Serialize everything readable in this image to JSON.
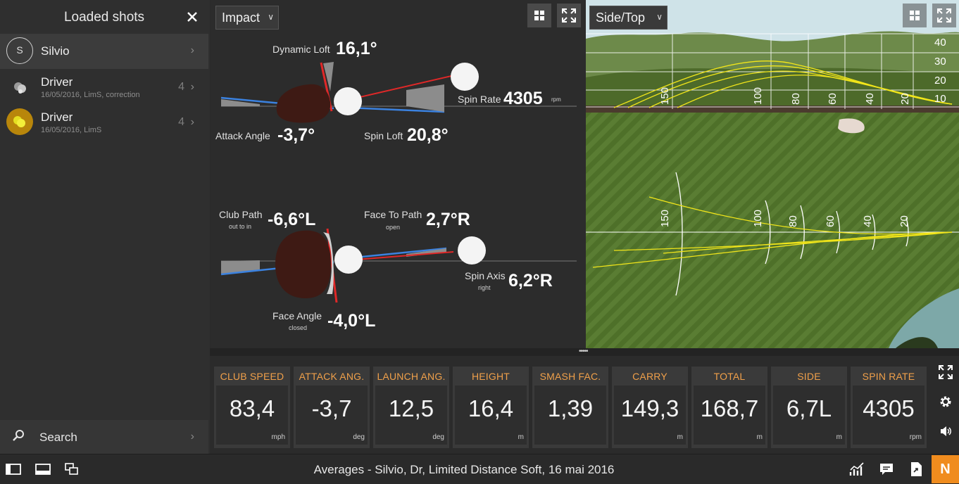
{
  "sidebar": {
    "title": "Loaded shots",
    "player": {
      "initial": "S",
      "name": "Silvio"
    },
    "shots": [
      {
        "title": "Driver",
        "subtitle": "16/05/2016, LimS, correction",
        "count": "4"
      },
      {
        "title": "Driver",
        "subtitle": "16/05/2016, LimS",
        "count": "4"
      }
    ],
    "search_label": "Search",
    "chevron": "›"
  },
  "impact": {
    "view_selector": "Impact",
    "metrics": {
      "dynamic_loft": {
        "label": "Dynamic Loft",
        "value": "16,1°"
      },
      "spin_rate": {
        "label": "Spin Rate",
        "value": "4305",
        "unit": "rpm"
      },
      "attack_angle": {
        "label": "Attack Angle",
        "value": "-3,7°"
      },
      "spin_loft": {
        "label": "Spin Loft",
        "value": "20,8°"
      },
      "club_path": {
        "label": "Club Path",
        "sub": "out to in",
        "value": "-6,6°L"
      },
      "face_to_path": {
        "label": "Face To Path",
        "sub": "open",
        "value": "2,7°R"
      },
      "spin_axis": {
        "label": "Spin Axis",
        "sub": "right",
        "value": "6,2°R"
      },
      "face_angle": {
        "label": "Face Angle",
        "sub": "closed",
        "value": "-4,0°L"
      }
    }
  },
  "trajectory": {
    "view_selector": "Side/Top",
    "side_height_labels": [
      "40",
      "30",
      "20",
      "10"
    ],
    "distance_labels": [
      "150",
      "100",
      "80",
      "60",
      "40",
      "20"
    ]
  },
  "stats": [
    {
      "label": "CLUB SPEED",
      "value": "83,4",
      "unit": "mph"
    },
    {
      "label": "ATTACK ANG.",
      "value": "-3,7",
      "unit": "deg"
    },
    {
      "label": "LAUNCH ANG.",
      "value": "12,5",
      "unit": "deg"
    },
    {
      "label": "HEIGHT",
      "value": "16,4",
      "unit": "m"
    },
    {
      "label": "SMASH FAC.",
      "value": "1,39",
      "unit": ""
    },
    {
      "label": "CARRY",
      "value": "149,3",
      "unit": "m"
    },
    {
      "label": "TOTAL",
      "value": "168,7",
      "unit": "m"
    },
    {
      "label": "SIDE",
      "value": "6,7L",
      "unit": "m"
    },
    {
      "label": "SPIN RATE",
      "value": "4305",
      "unit": "rpm"
    }
  ],
  "footer": {
    "status_text": "Averages - Silvio, Dr, Limited Distance Soft, 16 mai 2016",
    "n_button": "N"
  },
  "colors": {
    "accent_orange": "#f08c1e",
    "stat_header": "#f0a04a",
    "trajectory_line": "#f2e61a",
    "attack_line_blue": "#3b82e0",
    "face_line_red": "#e02828"
  },
  "icons": [
    "close-icon",
    "chevron-right-icon",
    "magnifier-icon",
    "grid-icon",
    "expand-icon",
    "gear-icon",
    "speaker-icon",
    "panel-left-icon",
    "panel-bottom-icon",
    "windows-icon",
    "chart-icon",
    "comment-icon",
    "file-export-icon"
  ]
}
